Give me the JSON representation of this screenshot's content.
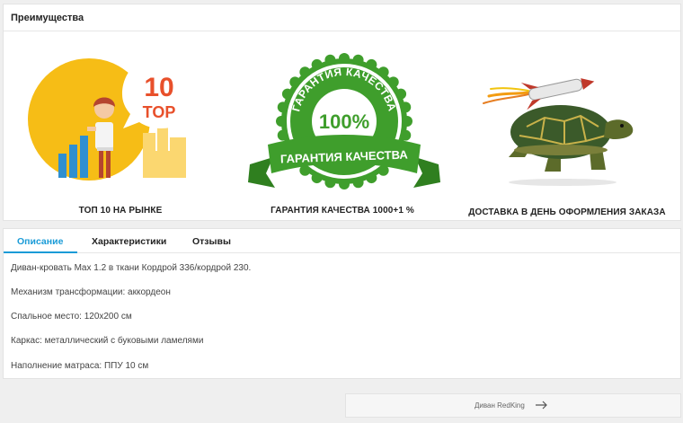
{
  "advantages": {
    "title": "Преимущества",
    "items": [
      {
        "caption": "ТОП 10 НА РЫНКЕ",
        "badge_line1": "10",
        "badge_line2": "TOP",
        "icon": "top10-icon"
      },
      {
        "caption": "ГАРАНТИЯ КАЧЕСТВА 1000+1 %",
        "seal_arc_text": "ГАРАНТИЯ КАЧЕСТВА",
        "seal_percent": "100%",
        "seal_ribbon_text": "ГАРАНТИЯ КАЧЕСТВА",
        "icon": "quality-seal-icon"
      },
      {
        "caption": "ДОСТАВКА В ДЕНЬ ОФОРМЛЕНИЯ ЗАКАЗА",
        "icon": "rocket-turtle-icon"
      }
    ]
  },
  "tabs": [
    {
      "label": "Описание",
      "active": true
    },
    {
      "label": "Характеристики",
      "active": false
    },
    {
      "label": "Отзывы",
      "active": false
    }
  ],
  "description": {
    "lines": [
      "Диван-кровать Max 1.2  в ткани Кордрой 336/кордрой 230.",
      "Механизм трансформации: аккордеон",
      "Спальное место: 120х200 см",
      "Каркас: металлический с буковыми ламелями",
      "Наполнение матраса: ППУ 10 см"
    ]
  },
  "next_product": {
    "label": "Диван RedKing",
    "icon": "arrow-right-icon"
  },
  "colors": {
    "accent": "#1a9bd7",
    "seal_green": "#3f9e2c",
    "top_yellow": "#f6bd16"
  }
}
